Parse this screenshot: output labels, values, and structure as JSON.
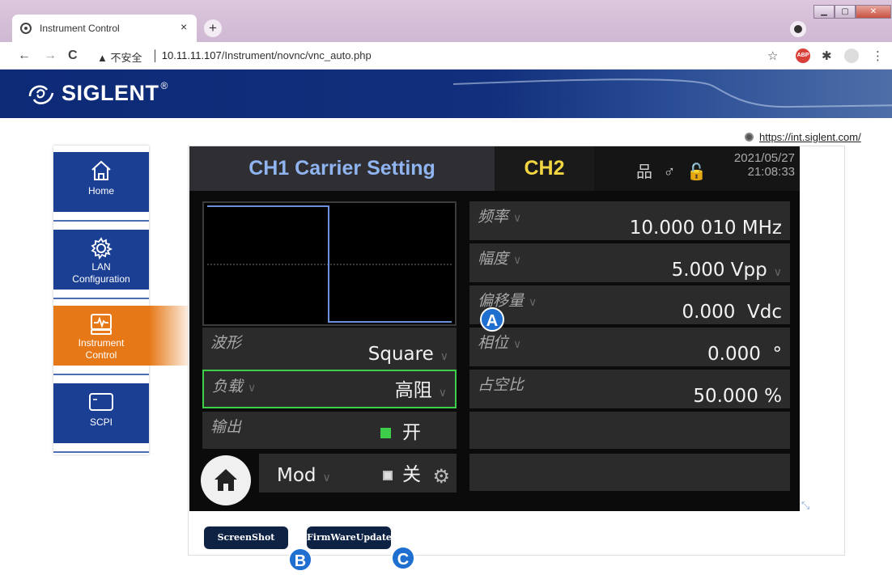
{
  "browser": {
    "tab_title": "Instrument Control",
    "tab_close": "×",
    "new_tab": "+",
    "nav_back": "←",
    "nav_forward": "→",
    "nav_reload": "C",
    "security_label": "▲ 不安全",
    "url_host": "10.11.11.107",
    "url_path": "/Instrument/novnc/vnc_auto.php",
    "star": "☆",
    "abp": "ABP",
    "puzzle": "✱",
    "menu": "⋮"
  },
  "brand": {
    "name": "SIGLENT",
    "reg": "®",
    "link": "https://int.siglent.com/"
  },
  "sidenav": {
    "items": [
      {
        "label": "Home"
      },
      {
        "label": "LAN\nConfiguration"
      },
      {
        "label": "Instrument\nControl"
      },
      {
        "label": "SCPI"
      }
    ],
    "active_index": 2
  },
  "screen": {
    "title": "CH1 Carrier Setting",
    "ch2": "CH2",
    "status_icons": "品 ♂ 🔓",
    "date": "2021/05/27",
    "time": "21:08:33",
    "params": {
      "freq_label": "频率",
      "freq_value": "10.000 010 MHz",
      "amp_label": "幅度",
      "amp_value": "5.000 Vpp",
      "offset_label": "偏移量",
      "offset_value": "0.000  Vdc",
      "phase_label": "相位",
      "phase_value": "0.000  °",
      "duty_label": "占空比",
      "duty_value": "50.000 %",
      "wave_label": "波形",
      "wave_value": "Square",
      "load_label": "负载",
      "load_value": "高阻",
      "output_label": "输出",
      "output_on": "开",
      "output_off": "关",
      "mod_label": "Mod"
    },
    "chevron": "∨",
    "gear": "⚙",
    "expand": "⤡"
  },
  "buttons": {
    "screenshot": "ScreenShot",
    "firmware": "FirmWareUpdate"
  },
  "markers": {
    "a": "A",
    "b": "B",
    "c": "C"
  },
  "colors": {
    "nav_blue": "#1b3f93",
    "nav_active": "#e67817",
    "screen_bg": "#0b0b0b",
    "ch_title": "#8fb4f0",
    "ch2": "#f2d641",
    "select_green": "#3ecf4a",
    "marker_blue": "#1e6fd0"
  }
}
